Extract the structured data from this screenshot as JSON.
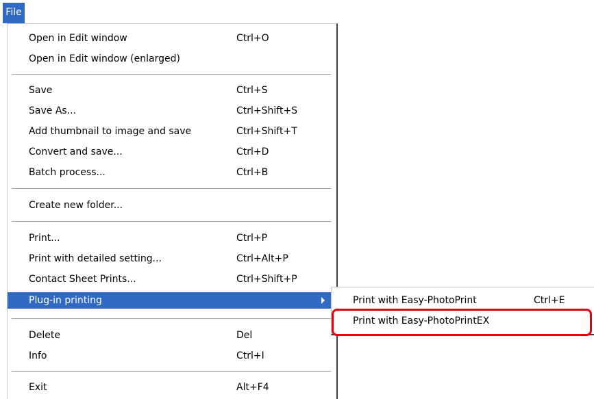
{
  "menubar": {
    "file_label": "File"
  },
  "menu": {
    "items": {
      "open_edit": {
        "label": "Open in Edit window",
        "shortcut": "Ctrl+O"
      },
      "open_edit_enlarged": {
        "label": "Open in Edit window (enlarged)",
        "shortcut": ""
      },
      "save": {
        "label": "Save",
        "shortcut": "Ctrl+S"
      },
      "save_as": {
        "label": "Save As...",
        "shortcut": "Ctrl+Shift+S"
      },
      "add_thumbnail": {
        "label": "Add thumbnail to image and save",
        "shortcut": "Ctrl+Shift+T"
      },
      "convert_save": {
        "label": "Convert and save...",
        "shortcut": "Ctrl+D"
      },
      "batch_process": {
        "label": "Batch process...",
        "shortcut": "Ctrl+B"
      },
      "create_folder": {
        "label": "Create new folder...",
        "shortcut": ""
      },
      "print": {
        "label": "Print...",
        "shortcut": "Ctrl+P"
      },
      "print_detailed": {
        "label": "Print with detailed setting...",
        "shortcut": "Ctrl+Alt+P"
      },
      "contact_sheet": {
        "label": "Contact Sheet Prints...",
        "shortcut": "Ctrl+Shift+P"
      },
      "plugin_printing": {
        "label": "Plug-in printing",
        "shortcut": ""
      },
      "delete": {
        "label": "Delete",
        "shortcut": "Del"
      },
      "info": {
        "label": "Info",
        "shortcut": "Ctrl+I"
      },
      "exit": {
        "label": "Exit",
        "shortcut": "Alt+F4"
      }
    }
  },
  "submenu": {
    "items": {
      "easy_photoprint": {
        "label": "Print with Easy-PhotoPrint",
        "shortcut": "Ctrl+E"
      },
      "easy_photoprint_ex": {
        "label": "Print with Easy-PhotoPrintEX",
        "shortcut": ""
      }
    }
  },
  "colors": {
    "highlight": "#316ac5",
    "callout": "#e60012"
  }
}
